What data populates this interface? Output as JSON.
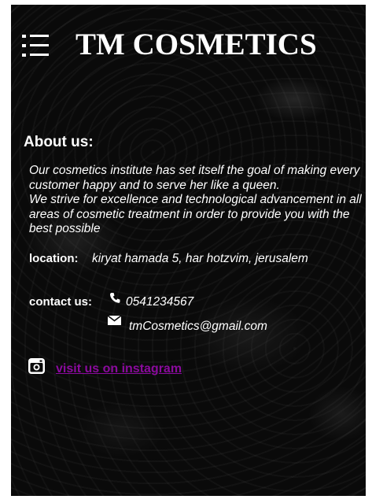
{
  "header": {
    "menu_icon": "hamburger-list-icon",
    "brand": "TM COSMETICS"
  },
  "about": {
    "heading": "About us:",
    "line1": "Our cosmetics institute has set itself the goal of making every customer happy and to serve her like a queen.",
    "line2": "We strive for excellence and technological advancement in all areas of cosmetic treatment in order to provide you with the best possible"
  },
  "location": {
    "label": "location:",
    "value": "kiryat hamada 5, har hotzvim, jerusalem"
  },
  "contact": {
    "label": "contact us:",
    "phone_icon": "phone-icon",
    "phone": "0541234567",
    "email_icon": "envelope-icon",
    "email": "tmCosmetics@gmail.com"
  },
  "social": {
    "instagram_icon": "instagram-icon",
    "link_text": "visit us on instagram"
  },
  "colors": {
    "background": "#0a0a0a",
    "text": "#ffffff",
    "link": "#8b0a9e"
  }
}
